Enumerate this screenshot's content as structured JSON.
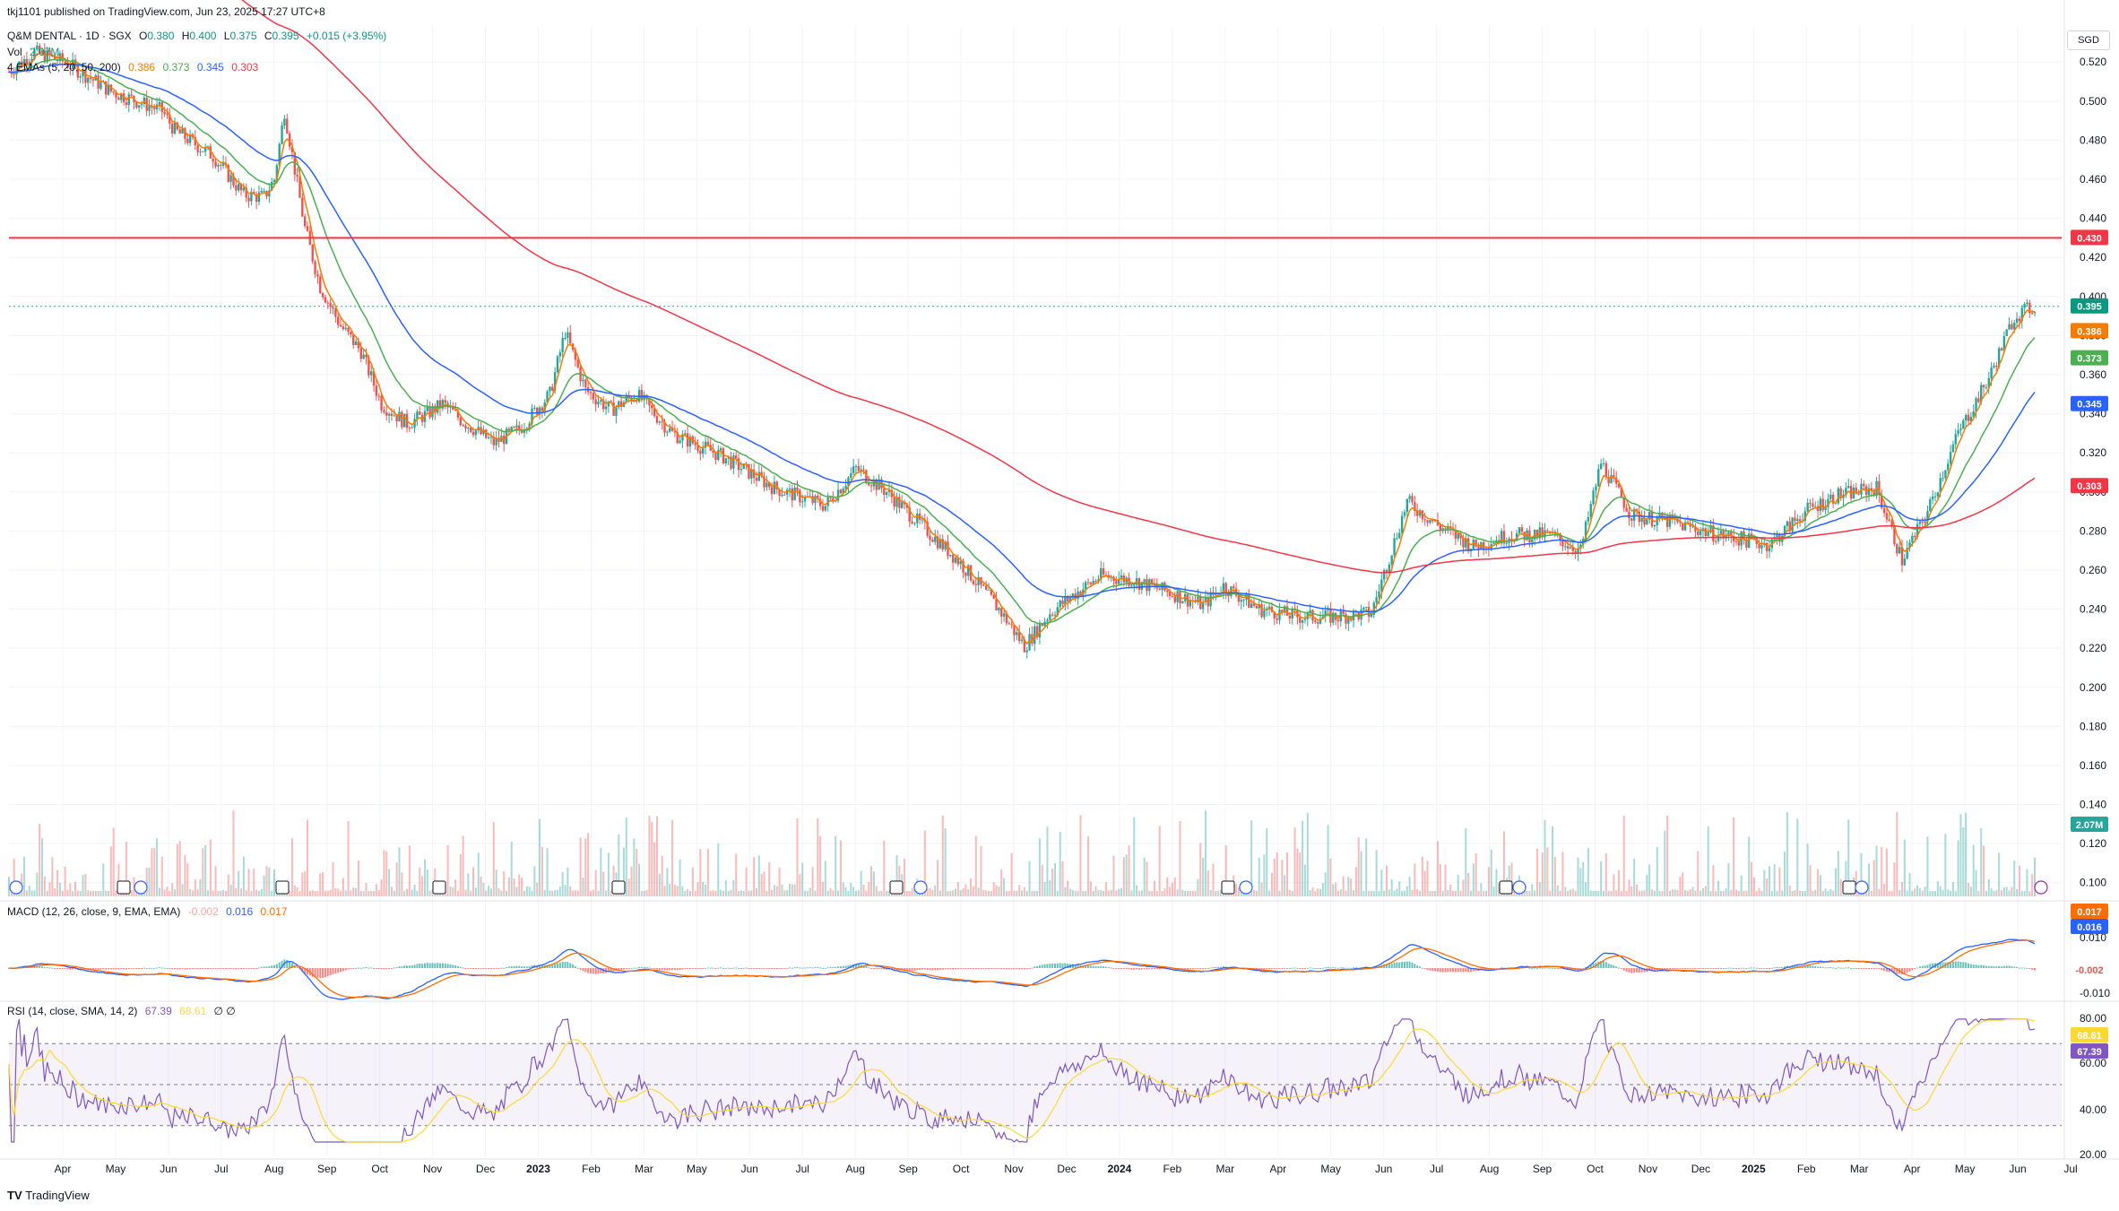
{
  "publish_line": "tkj1101 published on TradingView.com, Jun 23, 2025 17:27 UTC+8",
  "currency": "SGD",
  "footer": "TradingView",
  "symbol_line": {
    "name": "Q&M DENTAL · 1D · SGX",
    "o_label": "O",
    "o": "0.380",
    "h_label": "H",
    "h": "0.400",
    "l_label": "L",
    "l": "0.375",
    "c_label": "C",
    "c": "0.395",
    "chg": "+0.015 (+3.95%)"
  },
  "vol_line": {
    "label": "Vol",
    "value": "2.07M"
  },
  "ema_line": {
    "label": "4 EMAs (5, 20, 50, 200)",
    "v1": "0.386",
    "v2": "0.373",
    "v3": "0.345",
    "v4": "0.303"
  },
  "macd_line": {
    "label": "MACD (12, 26, close, 9, EMA, EMA)",
    "hist": "-0.002",
    "macd": "0.016",
    "signal": "0.017"
  },
  "rsi_line": {
    "label": "RSI (14, close, SMA, 14, 2)",
    "rsi": "67.39",
    "sma": "68.61",
    "extra": "∅ ∅"
  },
  "colors": {
    "up": "#26a69a",
    "down": "#ef5350",
    "ema5": "#f57c00",
    "ema20": "#4caf50",
    "ema50": "#2962ff",
    "ema200": "#f23645",
    "rsi": "#7e57c2",
    "rsi_ma": "#fdd835",
    "macd": "#2962ff",
    "signal": "#ff6d00",
    "hline": "#f23645"
  },
  "chart_data": {
    "type": "candlestick",
    "price_axis_ticks": [
      "0.520",
      "0.500",
      "0.480",
      "0.460",
      "0.440",
      "0.420",
      "0.400",
      "0.380",
      "0.360",
      "0.340",
      "0.320",
      "0.300",
      "0.280",
      "0.260",
      "0.240",
      "0.220",
      "0.200",
      "0.180",
      "0.160",
      "0.140",
      "0.120",
      "0.100"
    ],
    "price_range": [
      0.093,
      0.538
    ],
    "macd_axis_ticks": [
      "0.010",
      "-0.010"
    ],
    "rsi_axis_ticks": [
      "80.00",
      "60.00",
      "40.00",
      "20.00"
    ],
    "x_axis_labels": [
      "Apr",
      "May",
      "Jun",
      "Jul",
      "Aug",
      "Sep",
      "Oct",
      "Nov",
      "Dec",
      "2023",
      "Feb",
      "Mar",
      "May",
      "Jun",
      "Jul",
      "Aug",
      "Sep",
      "Oct",
      "Nov",
      "Dec",
      "2024",
      "Feb",
      "Mar",
      "Apr",
      "May",
      "Jun",
      "Jul",
      "Aug",
      "Sep",
      "Oct",
      "Nov",
      "Dec",
      "2025",
      "Feb",
      "Mar",
      "Apr",
      "May",
      "Jun",
      "Jul"
    ],
    "horizontal_line": {
      "value": 0.43,
      "label": "0.430"
    },
    "last_price": {
      "value": 0.395,
      "label": "0.395"
    },
    "ema_labels": [
      {
        "value": 0.386,
        "label": "0.386"
      },
      {
        "value": 0.373,
        "label": "0.373"
      },
      {
        "value": 0.345,
        "label": "0.345"
      },
      {
        "value": 0.303,
        "label": "0.303"
      }
    ],
    "volume_label": "2.07M",
    "macd_labels": {
      "signal": "0.017",
      "macd": "0.016",
      "hist": "-0.002"
    },
    "rsi_labels": {
      "sma": "68.61",
      "rsi": "67.39"
    },
    "price_path": [
      [
        0,
        0.515
      ],
      [
        10,
        0.525
      ],
      [
        22,
        0.52
      ],
      [
        40,
        0.505
      ],
      [
        60,
        0.495
      ],
      [
        65,
        0.485
      ],
      [
        80,
        0.472
      ],
      [
        92,
        0.452
      ],
      [
        100,
        0.451
      ],
      [
        104,
        0.46
      ],
      [
        108,
        0.495
      ],
      [
        116,
        0.435
      ],
      [
        122,
        0.405
      ],
      [
        130,
        0.385
      ],
      [
        138,
        0.372
      ],
      [
        146,
        0.345
      ],
      [
        156,
        0.335
      ],
      [
        164,
        0.34
      ],
      [
        170,
        0.345
      ],
      [
        178,
        0.336
      ],
      [
        190,
        0.325
      ],
      [
        200,
        0.332
      ],
      [
        212,
        0.35
      ],
      [
        218,
        0.382
      ],
      [
        226,
        0.352
      ],
      [
        236,
        0.342
      ],
      [
        246,
        0.35
      ],
      [
        260,
        0.33
      ],
      [
        280,
        0.318
      ],
      [
        300,
        0.302
      ],
      [
        320,
        0.293
      ],
      [
        332,
        0.312
      ],
      [
        344,
        0.3
      ],
      [
        356,
        0.285
      ],
      [
        372,
        0.265
      ],
      [
        388,
        0.24
      ],
      [
        398,
        0.221
      ],
      [
        408,
        0.238
      ],
      [
        418,
        0.248
      ],
      [
        428,
        0.257
      ],
      [
        440,
        0.255
      ],
      [
        456,
        0.248
      ],
      [
        468,
        0.242
      ],
      [
        476,
        0.252
      ],
      [
        490,
        0.24
      ],
      [
        506,
        0.236
      ],
      [
        520,
        0.236
      ],
      [
        534,
        0.238
      ],
      [
        548,
        0.295
      ],
      [
        560,
        0.283
      ],
      [
        574,
        0.272
      ],
      [
        588,
        0.278
      ],
      [
        604,
        0.278
      ],
      [
        616,
        0.27
      ],
      [
        624,
        0.315
      ],
      [
        636,
        0.288
      ],
      [
        650,
        0.285
      ],
      [
        670,
        0.278
      ],
      [
        690,
        0.273
      ],
      [
        704,
        0.29
      ],
      [
        716,
        0.298
      ],
      [
        732,
        0.302
      ],
      [
        742,
        0.265
      ],
      [
        752,
        0.29
      ],
      [
        764,
        0.33
      ],
      [
        776,
        0.358
      ],
      [
        786,
        0.39
      ],
      [
        794,
        0.395
      ]
    ]
  }
}
